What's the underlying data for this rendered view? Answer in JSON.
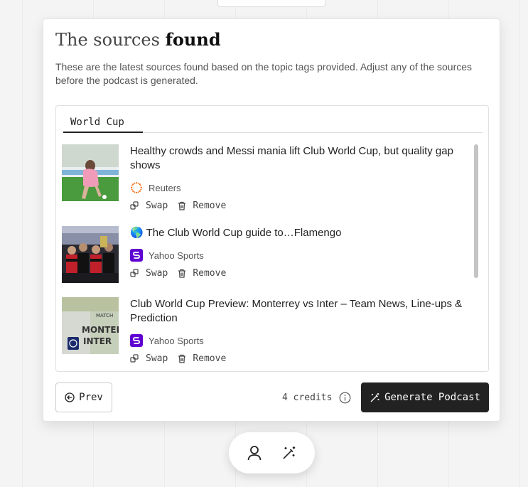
{
  "title": {
    "light": "The sources ",
    "bold": "found"
  },
  "description": "These are the latest sources found based on the topic tags provided. Adjust any of the sources before the podcast is generated.",
  "tabs": [
    {
      "label": "World Cup"
    }
  ],
  "sources": [
    {
      "headline": "Healthy crowds and Messi mania lift Club World Cup, but quality gap shows",
      "source_name": "Reuters",
      "source_icon": "reuters-logo",
      "swap_label": "Swap",
      "remove_label": "Remove"
    },
    {
      "headline": "🌎 The Club World Cup guide to…Flamengo",
      "source_name": "Yahoo Sports",
      "source_icon": "yahoo-sports-logo",
      "swap_label": "Swap",
      "remove_label": "Remove"
    },
    {
      "headline": "Club World Cup Preview: Monterrey vs Inter – Team News, Line-ups & Prediction",
      "source_name": "Yahoo Sports",
      "source_icon": "yahoo-sports-logo",
      "swap_label": "Swap",
      "remove_label": "Remove"
    }
  ],
  "footer": {
    "prev_label": "Prev",
    "credits_label": "4 credits",
    "generate_label": "Generate Podcast"
  },
  "colors": {
    "primary_button": "#222222",
    "yahoo_purple": "#5f01d1",
    "reuters_orange": "#fa6400"
  }
}
